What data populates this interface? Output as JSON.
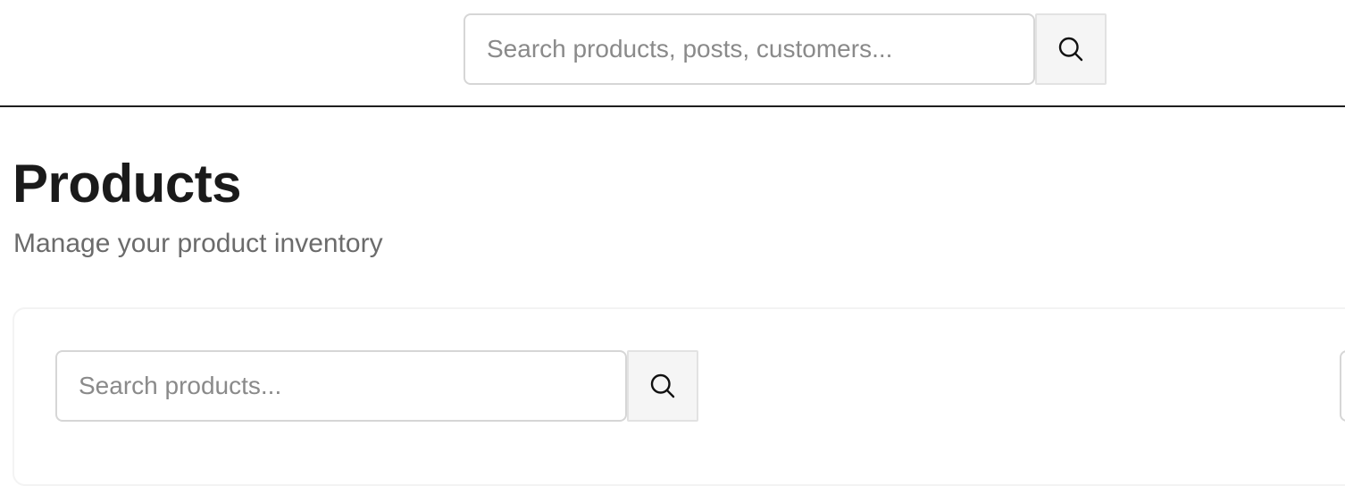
{
  "header": {
    "search": {
      "placeholder": "Search products, posts, customers...",
      "value": "",
      "button_icon": "search-icon"
    }
  },
  "page": {
    "title": "Products",
    "subtitle": "Manage your product inventory"
  },
  "products_panel": {
    "search": {
      "placeholder": "Search products...",
      "value": "",
      "button_icon": "search-icon"
    }
  },
  "colors": {
    "divider": "#1f1f1f",
    "input_border": "#d6d6d6",
    "button_bg": "#f5f5f5",
    "placeholder": "#8a8a8a",
    "subtitle": "#6b6b6b"
  }
}
